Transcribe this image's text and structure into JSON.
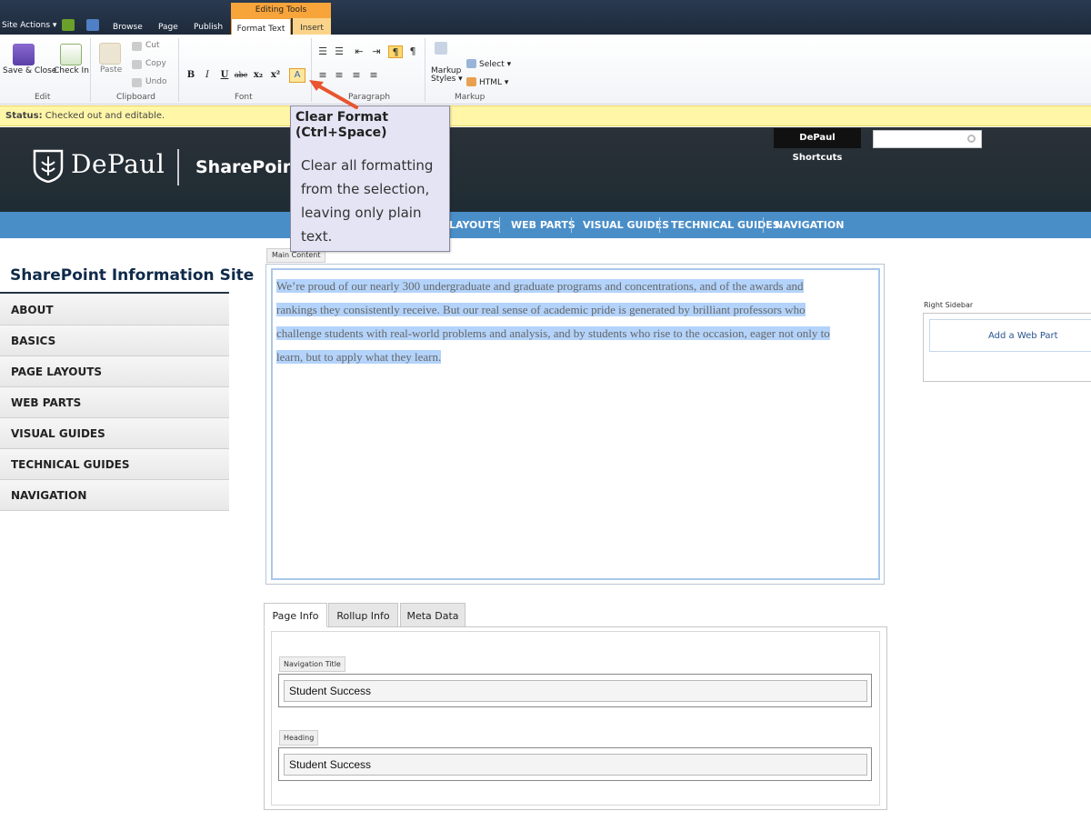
{
  "topbar": {
    "site_actions": "Site Actions ▾",
    "tabs": [
      "Browse",
      "Page",
      "Publish"
    ],
    "contextual_group": "Editing Tools",
    "contextual_tabs": [
      "Format Text",
      "Insert"
    ]
  },
  "ribbon": {
    "edit": {
      "save_close": "Save & Close",
      "check_in": "Check In",
      "label": "Edit"
    },
    "clipboard": {
      "paste": "Paste",
      "cut": "Cut",
      "copy": "Copy",
      "undo": "Undo",
      "label": "Clipboard"
    },
    "font": {
      "label": "Font",
      "buttons": [
        "B",
        "I",
        "U",
        "abc",
        "x₂",
        "x²"
      ]
    },
    "paragraph": {
      "label": "Paragraph"
    },
    "markup": {
      "markup_styles_line1": "Markup",
      "markup_styles_line2": "Styles ▾",
      "select": "Select ▾",
      "html": "HTML ▾",
      "label": "Markup"
    }
  },
  "status": {
    "key": "Status:",
    "value": "Checked out and editable."
  },
  "header": {
    "logo_text": "DePaul",
    "site_title": "SharePoint I",
    "shortcuts": "DePaul Shortcuts",
    "search_placeholder": ""
  },
  "nav": {
    "items": [
      "LAYOUTS",
      "WEB PARTS",
      "VISUAL GUIDES",
      "TECHNICAL GUIDES",
      "NAVIGATION"
    ]
  },
  "sidebar": {
    "title": "SharePoint Information Site",
    "items": [
      "ABOUT",
      "BASICS",
      "PAGE LAYOUTS",
      "WEB PARTS",
      "VISUAL GUIDES",
      "TECHNICAL GUIDES",
      "NAVIGATION"
    ]
  },
  "main": {
    "zone_label": "Main Content",
    "lines": [
      "We’re proud of our nearly 300 undergraduate and graduate programs and concentrations, and of the awards and",
      "rankings they consistently receive. But our real sense of academic pride is generated by brilliant professors who",
      "challenge students with real-world problems and analysis, and by students who rise to the occasion, eager not only to",
      "learn, but to apply what they learn."
    ]
  },
  "tooltip": {
    "title": "Clear Format (Ctrl+Space)",
    "body": "Clear all formatting from the selection, leaving only plain text."
  },
  "right_sidebar": {
    "label": "Right Sidebar",
    "add_web_part": "Add a Web Part"
  },
  "page_tabs": {
    "tabs": [
      "Page Info",
      "Rollup Info",
      "Meta Data"
    ],
    "fields": [
      {
        "label": "Navigation Title",
        "value": "Student Success"
      },
      {
        "label": "Heading",
        "value": "Student Success"
      }
    ]
  },
  "colors": {
    "accent_orange": "#f7a43b",
    "nav_blue": "#4a8ec8",
    "header_dark": "#1f2c33",
    "selection": "#b3d3fb",
    "callout_arrow": "#e8552f"
  }
}
